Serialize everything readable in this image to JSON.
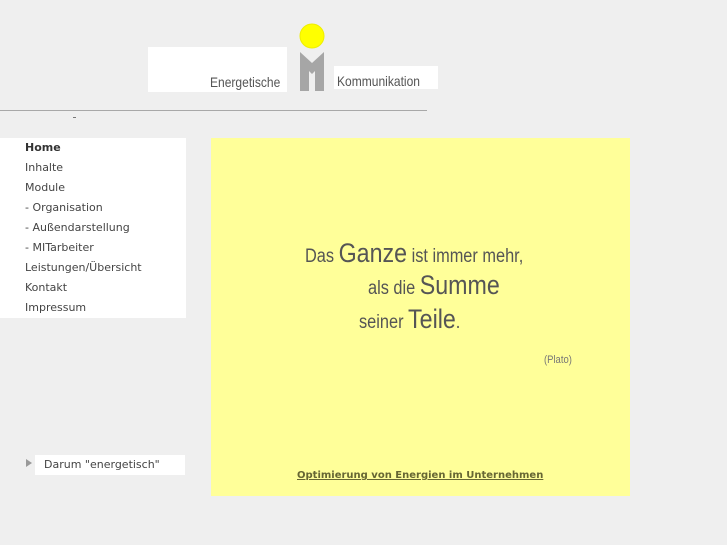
{
  "header": {
    "logo_left_text": "Energetische",
    "logo_right_text": "Kommunikation",
    "logo_icon": "sun-and-m-logo-icon",
    "logo_colors": {
      "sun": "#ffff00",
      "sun_outline": "#eeee00",
      "letter": "#a6a6a6"
    }
  },
  "nav": {
    "items": [
      {
        "label": "Home",
        "active": true
      },
      {
        "label": "Inhalte"
      },
      {
        "label": "Module"
      },
      {
        "label": "- Organisation"
      },
      {
        "label": "- Außendarstellung"
      },
      {
        "label": "- MITarbeiter"
      },
      {
        "label": "Leistungen/Übersicht"
      },
      {
        "label": "Kontakt"
      },
      {
        "label": "Impressum"
      }
    ]
  },
  "side_link": {
    "label": "Darum \"energetisch\"",
    "icon": "play-arrow-icon"
  },
  "content": {
    "background_color": "#ffff99",
    "quote": {
      "line1": {
        "a": "Das ",
        "b": "Ganze",
        "c": " ist immer mehr,"
      },
      "line2": {
        "a": "als die ",
        "b": "Summe"
      },
      "line3": {
        "a": "seiner ",
        "b": "Teile",
        "c": "."
      }
    },
    "attribution": "(Plato)",
    "bottom_link": "Optimierung von Energien im Unternehmen"
  }
}
